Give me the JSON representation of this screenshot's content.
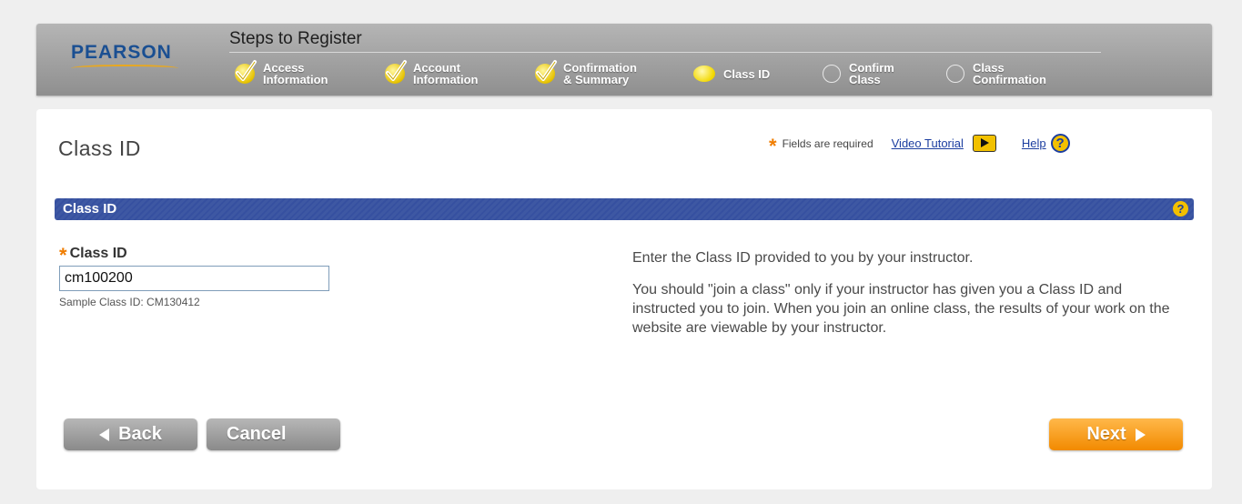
{
  "header": {
    "logo": "PEARSON",
    "steps_title": "Steps to Register",
    "steps": [
      {
        "label": "Access\nInformation",
        "state": "done"
      },
      {
        "label": "Account\nInformation",
        "state": "done"
      },
      {
        "label": "Confirmation\n& Summary",
        "state": "done"
      },
      {
        "label": "Class ID",
        "state": "current"
      },
      {
        "label": "Confirm\nClass",
        "state": "todo"
      },
      {
        "label": "Class\nConfirmation",
        "state": "todo"
      }
    ]
  },
  "page": {
    "title": "Class ID",
    "required_star": "*",
    "required_note": "Fields are required",
    "video_tutorial": "Video Tutorial",
    "help": "Help",
    "help_glyph": "?"
  },
  "section": {
    "title": "Class ID",
    "help_glyph": "?"
  },
  "form": {
    "class_id_label": "Class ID",
    "class_id_value": "cm100200",
    "sample_hint": "Sample Class ID: CM130412"
  },
  "info": {
    "p1": "Enter the Class ID provided to you by your instructor.",
    "p2": "You should \"join a class\" only if your instructor has given you a Class ID and instructed you to join. When you join an online class, the results of your work on the website are viewable by your instructor."
  },
  "buttons": {
    "back": "Back",
    "cancel": "Cancel",
    "next": "Next"
  },
  "colors": {
    "brand_blue": "#1a4f92",
    "accent_orange": "#f28a00",
    "section_blue": "#3e58a3",
    "link_blue": "#1c3ea0"
  }
}
